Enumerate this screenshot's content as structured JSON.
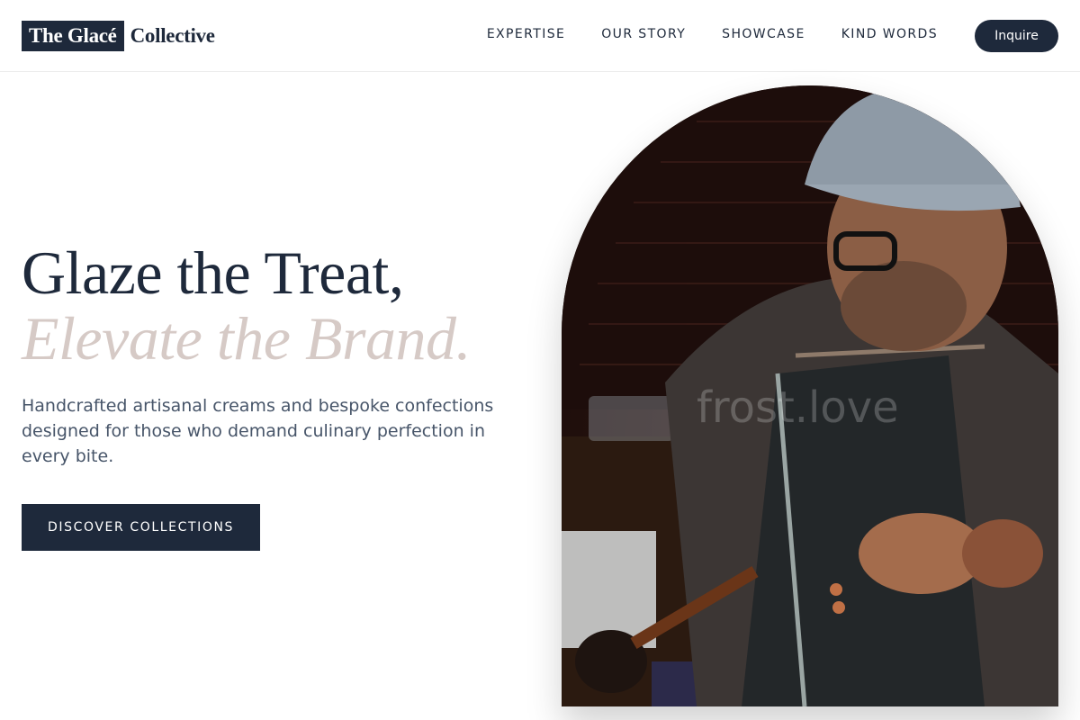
{
  "brand": {
    "highlight": "The Glacé",
    "rest": "Collective"
  },
  "nav": {
    "items": [
      {
        "label": "EXPERTISE"
      },
      {
        "label": "OUR STORY"
      },
      {
        "label": "SHOWCASE"
      },
      {
        "label": "KIND WORDS"
      }
    ],
    "cta_label": "Inquire"
  },
  "hero": {
    "title_line1": "Glaze the Treat,",
    "title_line2": "Elevate the Brand.",
    "description": "Handcrafted artisanal creams and bespoke confections designed for those who demand culinary perfection in every bite.",
    "button_label": "DISCOVER COLLECTIONS",
    "image_watermark": "frost.love"
  },
  "colors": {
    "primary": "#1e293b",
    "accent_muted": "#d6cac6",
    "body_text": "#475569"
  }
}
